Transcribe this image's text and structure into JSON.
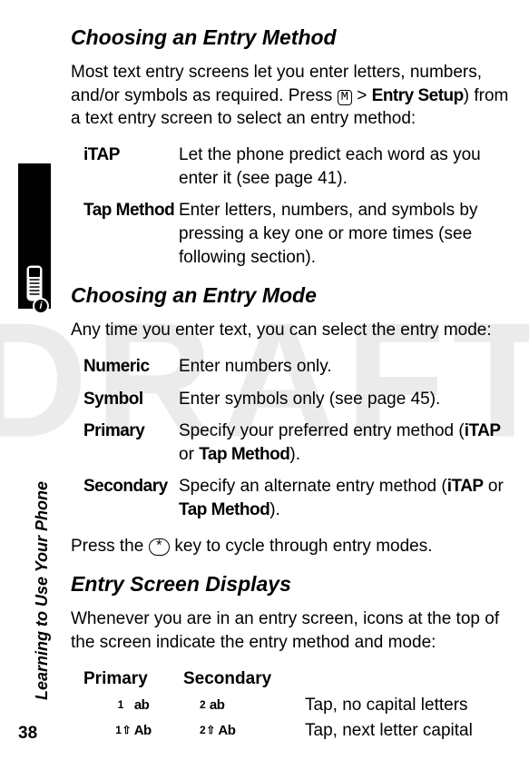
{
  "watermark": "DRAFT",
  "side_label": "Learning to Use Your Phone",
  "page_number": "38",
  "s1": {
    "heading": "Choosing an Entry Method",
    "para_a": "Most text entry screens let you enter letters, numbers, and/or symbols as required. Press ",
    "menu_key": "M",
    "para_b": " > ",
    "entry_setup": "Entry Setup",
    "para_c": ") from a text entry screen to select an entry method:",
    "defs": [
      {
        "term": "iTAP",
        "desc": "Let the phone predict each word as you enter it (see page 41)."
      },
      {
        "term": "Tap Method",
        "desc": "Enter letters, numbers, and symbols by pressing a key one or more times (see following section)."
      }
    ]
  },
  "s2": {
    "heading": "Choosing an Entry Mode",
    "para": "Any time you enter text, you can select the entry mode:",
    "defs": [
      {
        "term": "Numeric",
        "desc": "Enter numbers only."
      },
      {
        "term": "Symbol",
        "desc": "Enter symbols only (see page 45)."
      },
      {
        "term": "Primary",
        "desc_a": "Specify your preferred entry method (",
        "itap": "iTAP",
        "or": " or ",
        "tap": "Tap Method",
        "desc_b": ")."
      },
      {
        "term": "Secondary",
        "desc_a": "Specify an alternate entry method (",
        "itap": "iTAP",
        "or": " or ",
        "tap": "Tap Method",
        "desc_b": ")."
      }
    ],
    "press_a": "Press the ",
    "star": "*",
    "press_b": " key to cycle through entry modes."
  },
  "s3": {
    "heading": "Entry Screen Displays",
    "para": "Whenever you are in an entry screen, icons at the top of the screen indicate the entry method and mode:",
    "head_primary": "Primary",
    "head_secondary": "Secondary",
    "rows": [
      {
        "p_num": "1",
        "p_code": "ab",
        "s_num": "2",
        "s_code": "ab",
        "desc": "Tap, no capital letters"
      },
      {
        "p_num": "1",
        "p_shift": "⇧",
        "p_code": "Ab",
        "s_num": "2",
        "s_shift": "⇧",
        "s_code": "Ab",
        "desc": "Tap, next letter capital"
      }
    ]
  }
}
